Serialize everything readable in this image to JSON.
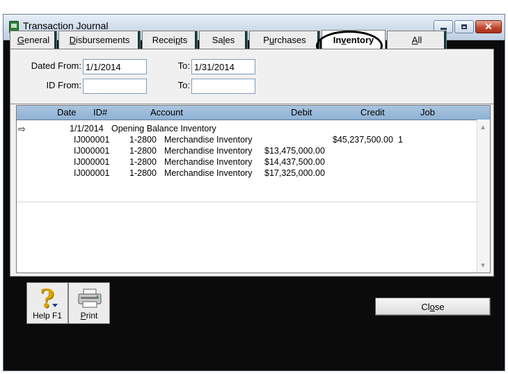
{
  "window": {
    "title": "Transaction Journal"
  },
  "tabs": [
    {
      "pre": "",
      "u": "G",
      "post": "eneral"
    },
    {
      "pre": "",
      "u": "D",
      "post": "isbursements"
    },
    {
      "pre": "Recei",
      "u": "p",
      "post": "ts"
    },
    {
      "pre": "Sa",
      "u": "l",
      "post": "es"
    },
    {
      "pre": "P",
      "u": "u",
      "post": "rchases"
    },
    {
      "pre": "In",
      "u": "v",
      "post": "entory"
    },
    {
      "pre": "",
      "u": "A",
      "post": "ll"
    }
  ],
  "active_tab": "Inventory",
  "filters": {
    "dated_from_label": "Dated From:",
    "dated_from_value": "1/1/2014",
    "to_label": "To:",
    "to_value": "1/31/2014",
    "id_from_label": "ID From:",
    "id_from_value": "",
    "id_to_label": "To:",
    "id_to_value": ""
  },
  "grid": {
    "columns": [
      "Date",
      "ID#",
      "Account",
      "Debit",
      "Credit",
      "Job"
    ],
    "rows": [
      {
        "arrow": "⇨",
        "date": "1/1/2014",
        "id": "",
        "acct_no": "",
        "account": "Opening Balance Inventory",
        "debit": "",
        "credit": "",
        "job": ""
      },
      {
        "arrow": "",
        "date": "",
        "id": "IJ000001",
        "acct_no": "1-2800",
        "account": "Merchandise Inventory",
        "debit": "",
        "credit": "$45,237,500.00",
        "job": "1"
      },
      {
        "arrow": "",
        "date": "",
        "id": "IJ000001",
        "acct_no": "1-2800",
        "account": "Merchandise Inventory",
        "debit": "$13,475,000.00",
        "credit": "",
        "job": ""
      },
      {
        "arrow": "",
        "date": "",
        "id": "IJ000001",
        "acct_no": "1-2800",
        "account": "Merchandise Inventory",
        "debit": "$14,437,500.00",
        "credit": "",
        "job": ""
      },
      {
        "arrow": "",
        "date": "",
        "id": "IJ000001",
        "acct_no": "1-2800",
        "account": "Merchandise Inventory",
        "debit": "$17,325,000.00",
        "credit": "",
        "job": ""
      }
    ]
  },
  "toolbar": {
    "help_label": "Help F1",
    "print_pre": "",
    "print_u": "P",
    "print_post": "rint"
  },
  "close_button": {
    "pre": "Cl",
    "u": "o",
    "post": "se"
  },
  "colors": {
    "grid_header": "#9fbcd9",
    "titlebar": "#cfdcea",
    "close": "#c0452c"
  }
}
